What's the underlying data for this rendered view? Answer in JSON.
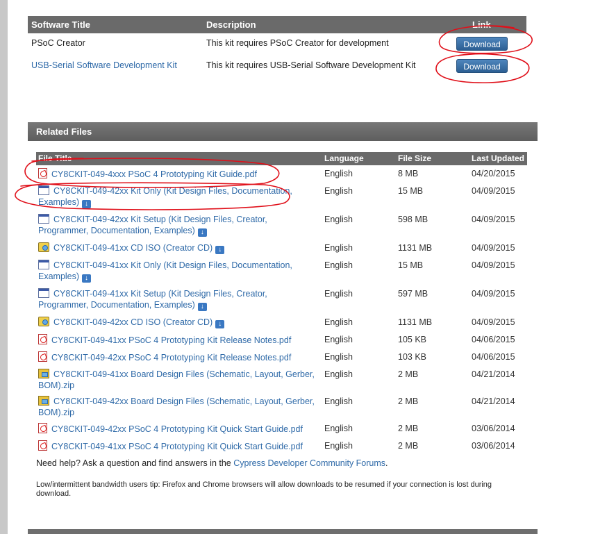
{
  "software": {
    "headers": {
      "title": "Software Title",
      "description": "Description",
      "link": "Link"
    },
    "rows": [
      {
        "title": "PSoC Creator",
        "description": "This kit requires PSoC Creator for development",
        "button": "Download"
      },
      {
        "title": "USB-Serial Software Development Kit",
        "description": "This kit requires USB-Serial Software Development Kit",
        "button": "Download"
      }
    ]
  },
  "related": {
    "heading": "Related Files",
    "headers": {
      "title": "File Title",
      "language": "Language",
      "size": "File Size",
      "updated": "Last Updated"
    },
    "files": [
      {
        "icon": "pdf-icon",
        "title": "CY8CKIT-049-4xxx PSoC 4 Prototyping Kit Guide.pdf",
        "language": "English",
        "size": "8 MB",
        "updated": "04/20/2015"
      },
      {
        "icon": "installer-icon",
        "title": "CY8CKIT-049-42xx Kit Only (Kit Design Files, Documentation, Examples)",
        "language": "English",
        "size": "15 MB",
        "updated": "04/09/2015"
      },
      {
        "icon": "installer-icon",
        "title": "CY8CKIT-049-42xx Kit Setup (Kit Design Files, Creator, Programmer, Documentation, Examples)",
        "language": "English",
        "size": "598 MB",
        "updated": "04/09/2015"
      },
      {
        "icon": "cd-icon",
        "title": "CY8CKIT-049-41xx CD ISO (Creator CD)",
        "language": "English",
        "size": "1131 MB",
        "updated": "04/09/2015"
      },
      {
        "icon": "installer-icon",
        "title": "CY8CKIT-049-41xx Kit Only (Kit Design Files, Documentation, Examples)",
        "language": "English",
        "size": "15 MB",
        "updated": "04/09/2015"
      },
      {
        "icon": "installer-icon",
        "title": "CY8CKIT-049-41xx Kit Setup (Kit Design Files, Creator, Programmer, Documentation, Examples)",
        "language": "English",
        "size": "597 MB",
        "updated": "04/09/2015"
      },
      {
        "icon": "cd-icon",
        "title": "CY8CKIT-049-42xx CD ISO (Creator CD)",
        "language": "English",
        "size": "1131 MB",
        "updated": "04/09/2015"
      },
      {
        "icon": "pdf-icon",
        "title": "CY8CKIT-049-41xx PSoC 4 Prototyping Kit Release Notes.pdf",
        "language": "English",
        "size": "105 KB",
        "updated": "04/06/2015"
      },
      {
        "icon": "pdf-icon",
        "title": "CY8CKIT-049-42xx PSoC 4 Prototyping Kit Release Notes.pdf",
        "language": "English",
        "size": "103 KB",
        "updated": "04/06/2015"
      },
      {
        "icon": "zip-icon",
        "title": "CY8CKIT-049-41xx Board Design Files (Schematic, Layout, Gerber, BOM).zip",
        "language": "English",
        "size": "2 MB",
        "updated": "04/21/2014"
      },
      {
        "icon": "zip-icon",
        "title": "CY8CKIT-049-42xx Board Design Files (Schematic, Layout, Gerber, BOM).zip",
        "language": "English",
        "size": "2 MB",
        "updated": "04/21/2014"
      },
      {
        "icon": "pdf-icon",
        "title": "CY8CKIT-049-42xx PSoC 4 Prototyping Kit Quick Start Guide.pdf",
        "language": "English",
        "size": "2 MB",
        "updated": "03/06/2014"
      },
      {
        "icon": "pdf-icon",
        "title": "CY8CKIT-049-41xx PSoC 4 Prototyping Kit Quick Start Guide.pdf",
        "language": "English",
        "size": "2 MB",
        "updated": "03/06/2014"
      }
    ]
  },
  "help": {
    "prefix": "Need help? Ask a question and find answers in the ",
    "link": "Cypress Developer Community Forums",
    "suffix": "."
  },
  "tip": "Low/intermittent bandwidth users tip: Firefox and Chrome browsers will allow downloads to be resumed if your connection is lost during download.",
  "colors": {
    "link": "#2f6aa8",
    "header": "#6a6a6a",
    "annotation": "#e0101a",
    "button": "#2c5f93"
  }
}
